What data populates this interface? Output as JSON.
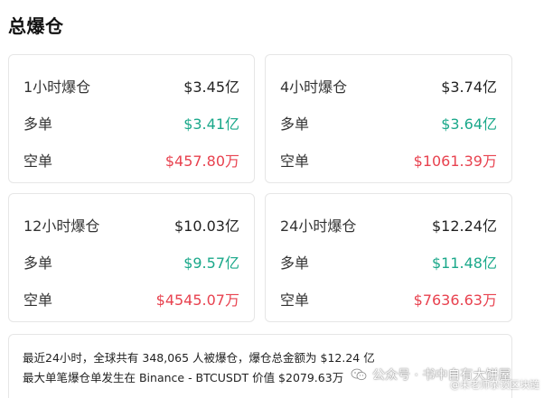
{
  "title": "总爆仓",
  "cards": [
    {
      "period_label": "1小时爆仓",
      "total": "$3.45亿",
      "long_label": "多单",
      "long_value": "$3.41亿",
      "short_label": "空单",
      "short_value": "$457.80万"
    },
    {
      "period_label": "4小时爆仓",
      "total": "$3.74亿",
      "long_label": "多单",
      "long_value": "$3.64亿",
      "short_label": "空单",
      "short_value": "$1061.39万"
    },
    {
      "period_label": "12小时爆仓",
      "total": "$10.03亿",
      "long_label": "多单",
      "long_value": "$9.57亿",
      "short_label": "空单",
      "short_value": "$4545.07万"
    },
    {
      "period_label": "24小时爆仓",
      "total": "$12.24亿",
      "long_label": "多单",
      "long_value": "$11.48亿",
      "short_label": "空单",
      "short_value": "$7636.63万"
    }
  ],
  "summary": {
    "line1": "最近24小时，全球共有 348,065 人被爆仓，爆仓总金额为 $12.24 亿",
    "line2": "最大单笔爆仓单发生在 Binance - BTCUSDT 价值 $2079.63万"
  },
  "watermark": {
    "text": "公众号 · 书中自有大饼屋",
    "sub": "@未老师杂谈区块链",
    "icon": "wechat-icon"
  },
  "colors": {
    "long": "#1aa88a",
    "short": "#e8424f"
  }
}
